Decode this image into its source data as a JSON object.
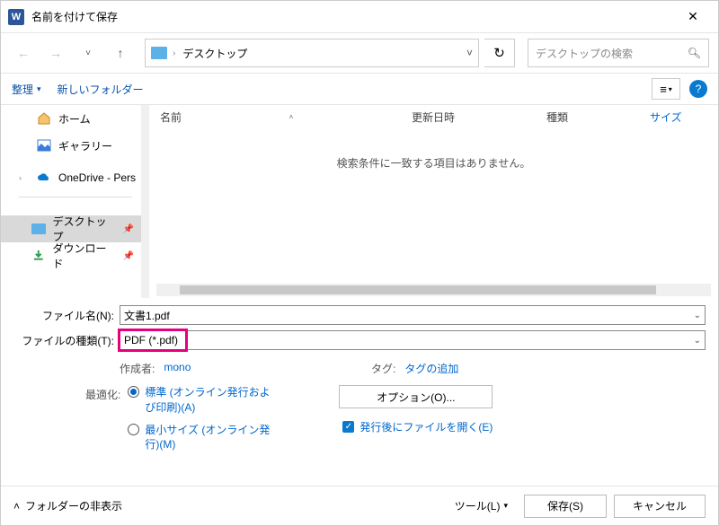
{
  "titlebar": {
    "title": "名前を付けて保存"
  },
  "nav": {
    "crumb": "デスクトップ",
    "search_placeholder": "デスクトップの検索"
  },
  "toolbar": {
    "organize": "整理",
    "newfolder": "新しいフォルダー"
  },
  "sidebar": {
    "home": "ホーム",
    "gallery": "ギャラリー",
    "onedrive": "OneDrive - Pers",
    "desktop": "デスクトップ",
    "downloads": "ダウンロード"
  },
  "columns": {
    "name": "名前",
    "date": "更新日時",
    "type": "種類",
    "size": "サイズ"
  },
  "list": {
    "empty": "検索条件に一致する項目はありません。"
  },
  "form": {
    "filename_label": "ファイル名(N):",
    "filename_value": "文書1.pdf",
    "filetype_label": "ファイルの種類(T):",
    "filetype_value": "PDF (*.pdf)"
  },
  "meta": {
    "author_label": "作成者:",
    "author_value": "mono",
    "tag_label": "タグ:",
    "tag_value": "タグの追加"
  },
  "optimize": {
    "label": "最適化:",
    "std": "標準 (オンライン発行および印刷)(A)",
    "min": "最小サイズ (オンライン発行)(M)",
    "options_btn": "オプション(O)...",
    "openafter": "発行後にファイルを開く(E)"
  },
  "footer": {
    "hide": "フォルダーの非表示",
    "tools": "ツール(L)",
    "save": "保存(S)",
    "cancel": "キャンセル"
  }
}
